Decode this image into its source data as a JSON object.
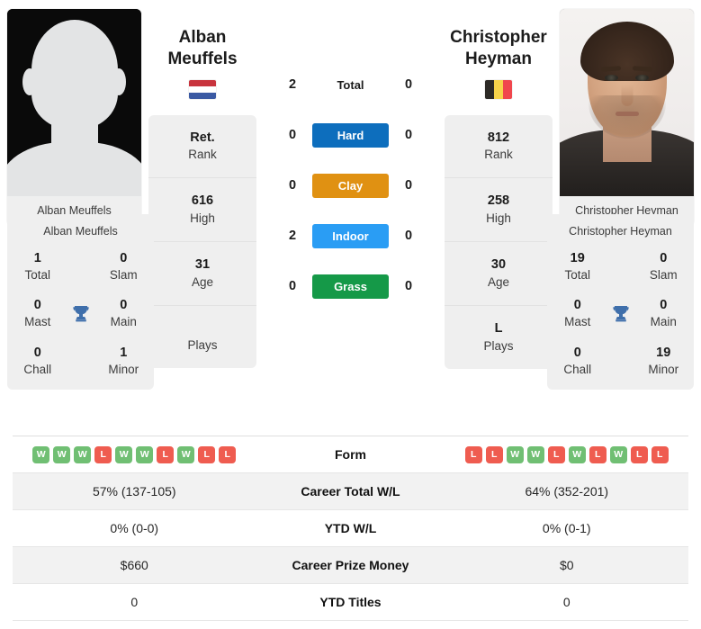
{
  "players": {
    "left": {
      "first_name": "Alban",
      "last_name": "Meuffels",
      "full_name": "Alban Meuffels",
      "photo_caption": "Alban Meuffels",
      "flag_country": "Netherlands",
      "flag_orientation": "horizontal",
      "flag_colors": [
        "#c8343d",
        "#ffffff",
        "#3b5aa3"
      ],
      "rank_value": "Ret.",
      "rank_label": "Rank",
      "high_value": "616",
      "high_label": "High",
      "age_value": "31",
      "age_label": "Age",
      "plays_value": "",
      "plays_label": "Plays",
      "titles": {
        "card_name": "Alban Meuffels",
        "total_value": "1",
        "total_label": "Total",
        "slam_value": "0",
        "slam_label": "Slam",
        "mast_value": "0",
        "mast_label": "Mast",
        "main_value": "0",
        "main_label": "Main",
        "chall_value": "0",
        "chall_label": "Chall",
        "minor_value": "1",
        "minor_label": "Minor"
      },
      "h2h": {
        "total": "2",
        "hard": "0",
        "clay": "0",
        "indoor": "2",
        "grass": "0"
      },
      "form": [
        "W",
        "W",
        "W",
        "L",
        "W",
        "W",
        "L",
        "W",
        "L",
        "L"
      ],
      "career_total_wl": "57% (137-105)",
      "ytd_wl": "0% (0-0)",
      "career_prize_money": "$660",
      "ytd_titles": "0"
    },
    "right": {
      "first_name": "Christopher",
      "last_name": "Heyman",
      "full_name": "Christopher Heyman",
      "photo_caption": "Christopher Heyman",
      "flag_country": "Belgium",
      "flag_orientation": "vertical",
      "flag_colors": [
        "#2d2a26",
        "#f7d34a",
        "#f0464d"
      ],
      "rank_value": "812",
      "rank_label": "Rank",
      "high_value": "258",
      "high_label": "High",
      "age_value": "30",
      "age_label": "Age",
      "plays_value": "L",
      "plays_label": "Plays",
      "titles": {
        "card_name": "Christopher Heyman",
        "total_value": "19",
        "total_label": "Total",
        "slam_value": "0",
        "slam_label": "Slam",
        "mast_value": "0",
        "mast_label": "Mast",
        "main_value": "0",
        "main_label": "Main",
        "chall_value": "0",
        "chall_label": "Chall",
        "minor_value": "19",
        "minor_label": "Minor"
      },
      "h2h": {
        "total": "0",
        "hard": "0",
        "clay": "0",
        "indoor": "0",
        "grass": "0"
      },
      "form": [
        "L",
        "L",
        "W",
        "W",
        "L",
        "W",
        "L",
        "W",
        "L",
        "L"
      ],
      "career_total_wl": "64% (352-201)",
      "ytd_wl": "0% (0-1)",
      "career_prize_money": "$0",
      "ytd_titles": "0"
    }
  },
  "surfaces": [
    {
      "key": "total",
      "label": "Total",
      "color": "",
      "text_color": "#1b1b1b"
    },
    {
      "key": "hard",
      "label": "Hard",
      "color": "#0d6ebd",
      "text_color": "#ffffff"
    },
    {
      "key": "clay",
      "label": "Clay",
      "color": "#e09112",
      "text_color": "#ffffff"
    },
    {
      "key": "indoor",
      "label": "Indoor",
      "color": "#2a9df4",
      "text_color": "#ffffff"
    },
    {
      "key": "grass",
      "label": "Grass",
      "color": "#159948",
      "text_color": "#ffffff"
    }
  ],
  "comparison_table": [
    {
      "label": "Form",
      "type": "form",
      "left": "form",
      "right": "form"
    },
    {
      "label": "Career Total W/L",
      "type": "text",
      "left": "career_total_wl",
      "right": "career_total_wl"
    },
    {
      "label": "YTD W/L",
      "type": "text",
      "left": "ytd_wl",
      "right": "ytd_wl"
    },
    {
      "label": "Career Prize Money",
      "type": "text",
      "left": "career_prize_money",
      "right": "career_prize_money"
    },
    {
      "label": "YTD Titles",
      "type": "text",
      "left": "ytd_titles",
      "right": "ytd_titles"
    }
  ],
  "form_colors": {
    "W": "#70bf73",
    "L": "#ef5c50"
  },
  "trophy_color": "#3f6fab",
  "icons": {
    "trophy": "trophy-icon"
  }
}
